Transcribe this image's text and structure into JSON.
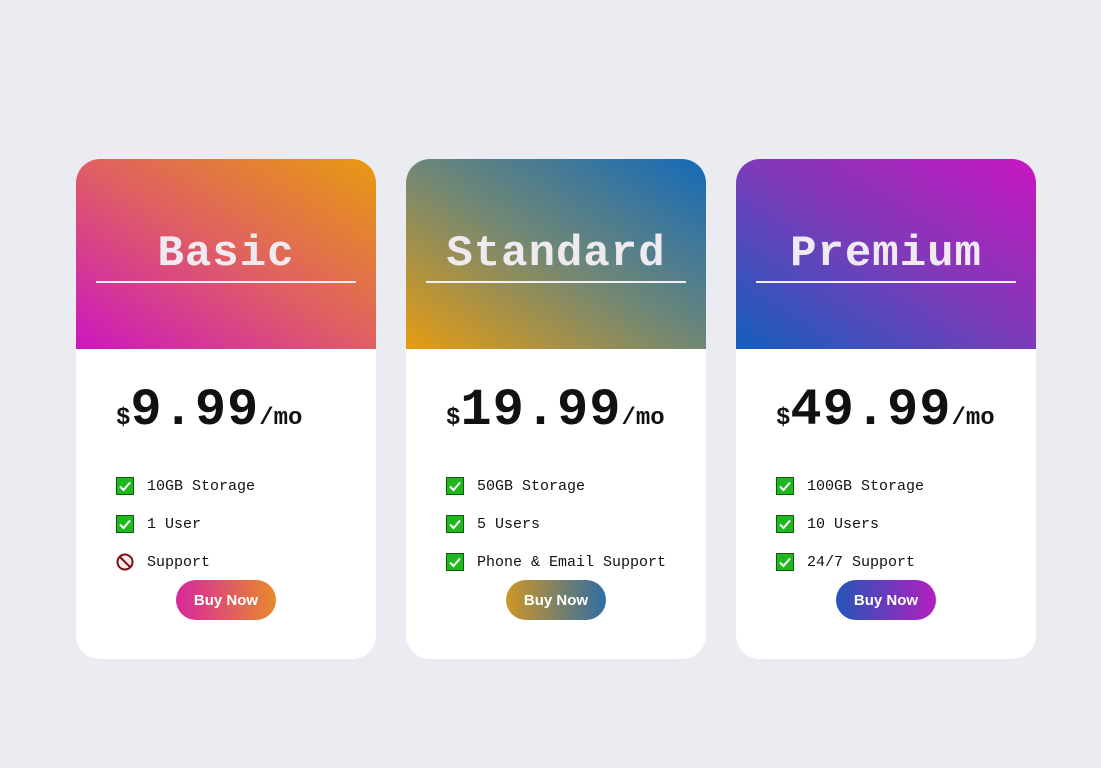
{
  "plans": [
    {
      "name": "Basic",
      "currency": "$",
      "amount": "9.99",
      "period": "/mo",
      "features": [
        {
          "text": "10GB Storage",
          "included": true
        },
        {
          "text": "1 User",
          "included": true
        },
        {
          "text": "Support",
          "included": false
        }
      ],
      "button_label": "Buy Now"
    },
    {
      "name": "Standard",
      "currency": "$",
      "amount": "19.99",
      "period": "/mo",
      "features": [
        {
          "text": "50GB Storage",
          "included": true
        },
        {
          "text": "5 Users",
          "included": true
        },
        {
          "text": "Phone & Email Support",
          "included": true
        }
      ],
      "button_label": "Buy Now"
    },
    {
      "name": "Premium",
      "currency": "$",
      "amount": "49.99",
      "period": "/mo",
      "features": [
        {
          "text": "100GB Storage",
          "included": true
        },
        {
          "text": "10 Users",
          "included": true
        },
        {
          "text": "24/7 Support",
          "included": true
        }
      ],
      "button_label": "Buy Now"
    }
  ],
  "icons": {
    "included": "check-box-icon",
    "excluded": "prohibited-icon"
  },
  "colors": {
    "page_background": "#ebecf1",
    "check_green": "#1fb81f",
    "prohibited_red": "#c0392b"
  }
}
